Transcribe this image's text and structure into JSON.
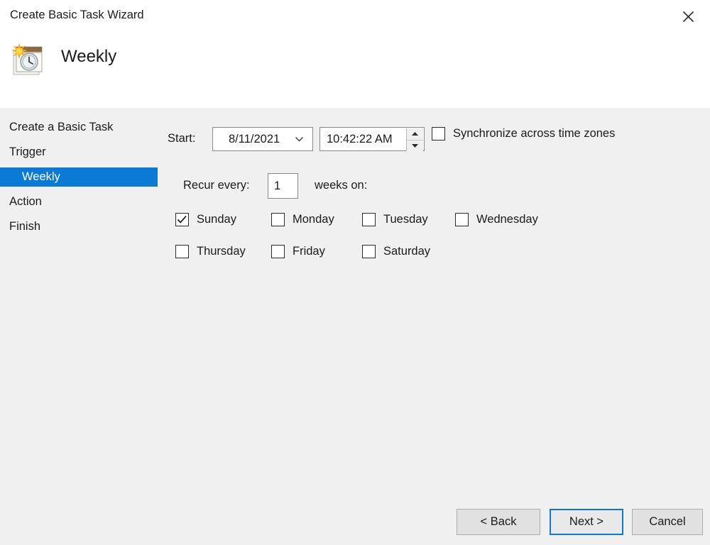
{
  "window": {
    "title": "Create Basic Task Wizard",
    "close_icon": "close-icon"
  },
  "header": {
    "icon": "weekly-task-calendar-clock-icon",
    "title": "Weekly"
  },
  "sidebar": {
    "items": [
      {
        "label": "Create a Basic Task",
        "selected": false,
        "indent": false
      },
      {
        "label": "Trigger",
        "selected": false,
        "indent": false
      },
      {
        "label": "Weekly",
        "selected": true,
        "indent": true
      },
      {
        "label": "Action",
        "selected": false,
        "indent": false
      },
      {
        "label": "Finish",
        "selected": false,
        "indent": false
      }
    ],
    "selected_color": "#0a7ad6"
  },
  "form": {
    "start_label": "Start:",
    "start_date": "8/11/2021",
    "start_date_chevron": "chevron-down-icon",
    "start_time": "10:42:22 AM",
    "spinner_up_icon": "spinner-up-icon",
    "spinner_down_icon": "spinner-down-icon",
    "sync_timezones": {
      "label": "Synchronize across time zones",
      "checked": false
    },
    "recur_label": "Recur every:",
    "recur_value": "1",
    "recur_suffix": "weeks on:",
    "days": [
      {
        "label": "Sunday",
        "checked": true
      },
      {
        "label": "Monday",
        "checked": false
      },
      {
        "label": "Tuesday",
        "checked": false
      },
      {
        "label": "Wednesday",
        "checked": false
      },
      {
        "label": "Thursday",
        "checked": false
      },
      {
        "label": "Friday",
        "checked": false
      },
      {
        "label": "Saturday",
        "checked": false
      }
    ]
  },
  "footer": {
    "back_label": "< Back",
    "next_label": "Next >",
    "cancel_label": "Cancel",
    "default_button": "Next >"
  }
}
